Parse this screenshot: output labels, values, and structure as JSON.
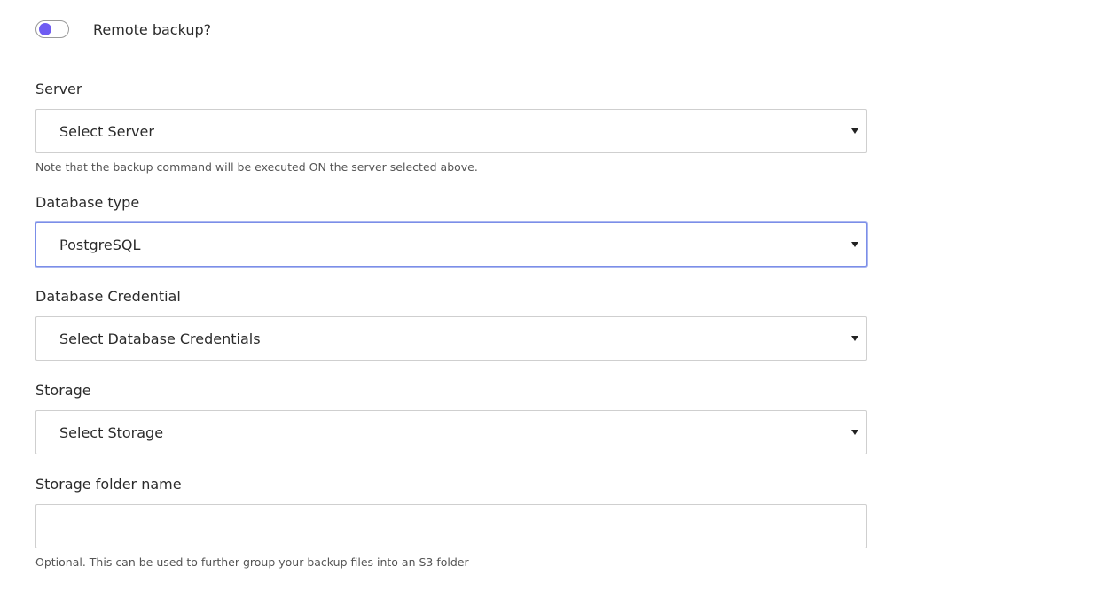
{
  "remote_backup": {
    "label": "Remote backup?",
    "enabled": true,
    "accent_color": "#6f5cf2"
  },
  "server": {
    "label": "Server",
    "selected": "Select Server",
    "help": "Note that the backup command will be executed ON the server selected above."
  },
  "database_type": {
    "label": "Database type",
    "selected": "PostgreSQL"
  },
  "database_credential": {
    "label": "Database Credential",
    "selected": "Select Database Credentials"
  },
  "storage": {
    "label": "Storage",
    "selected": "Select Storage"
  },
  "storage_folder": {
    "label": "Storage folder name",
    "value": "",
    "help": "Optional. This can be used to further group your backup files into an S3 folder"
  },
  "icons": {
    "dropdown": "caret-down-icon"
  }
}
